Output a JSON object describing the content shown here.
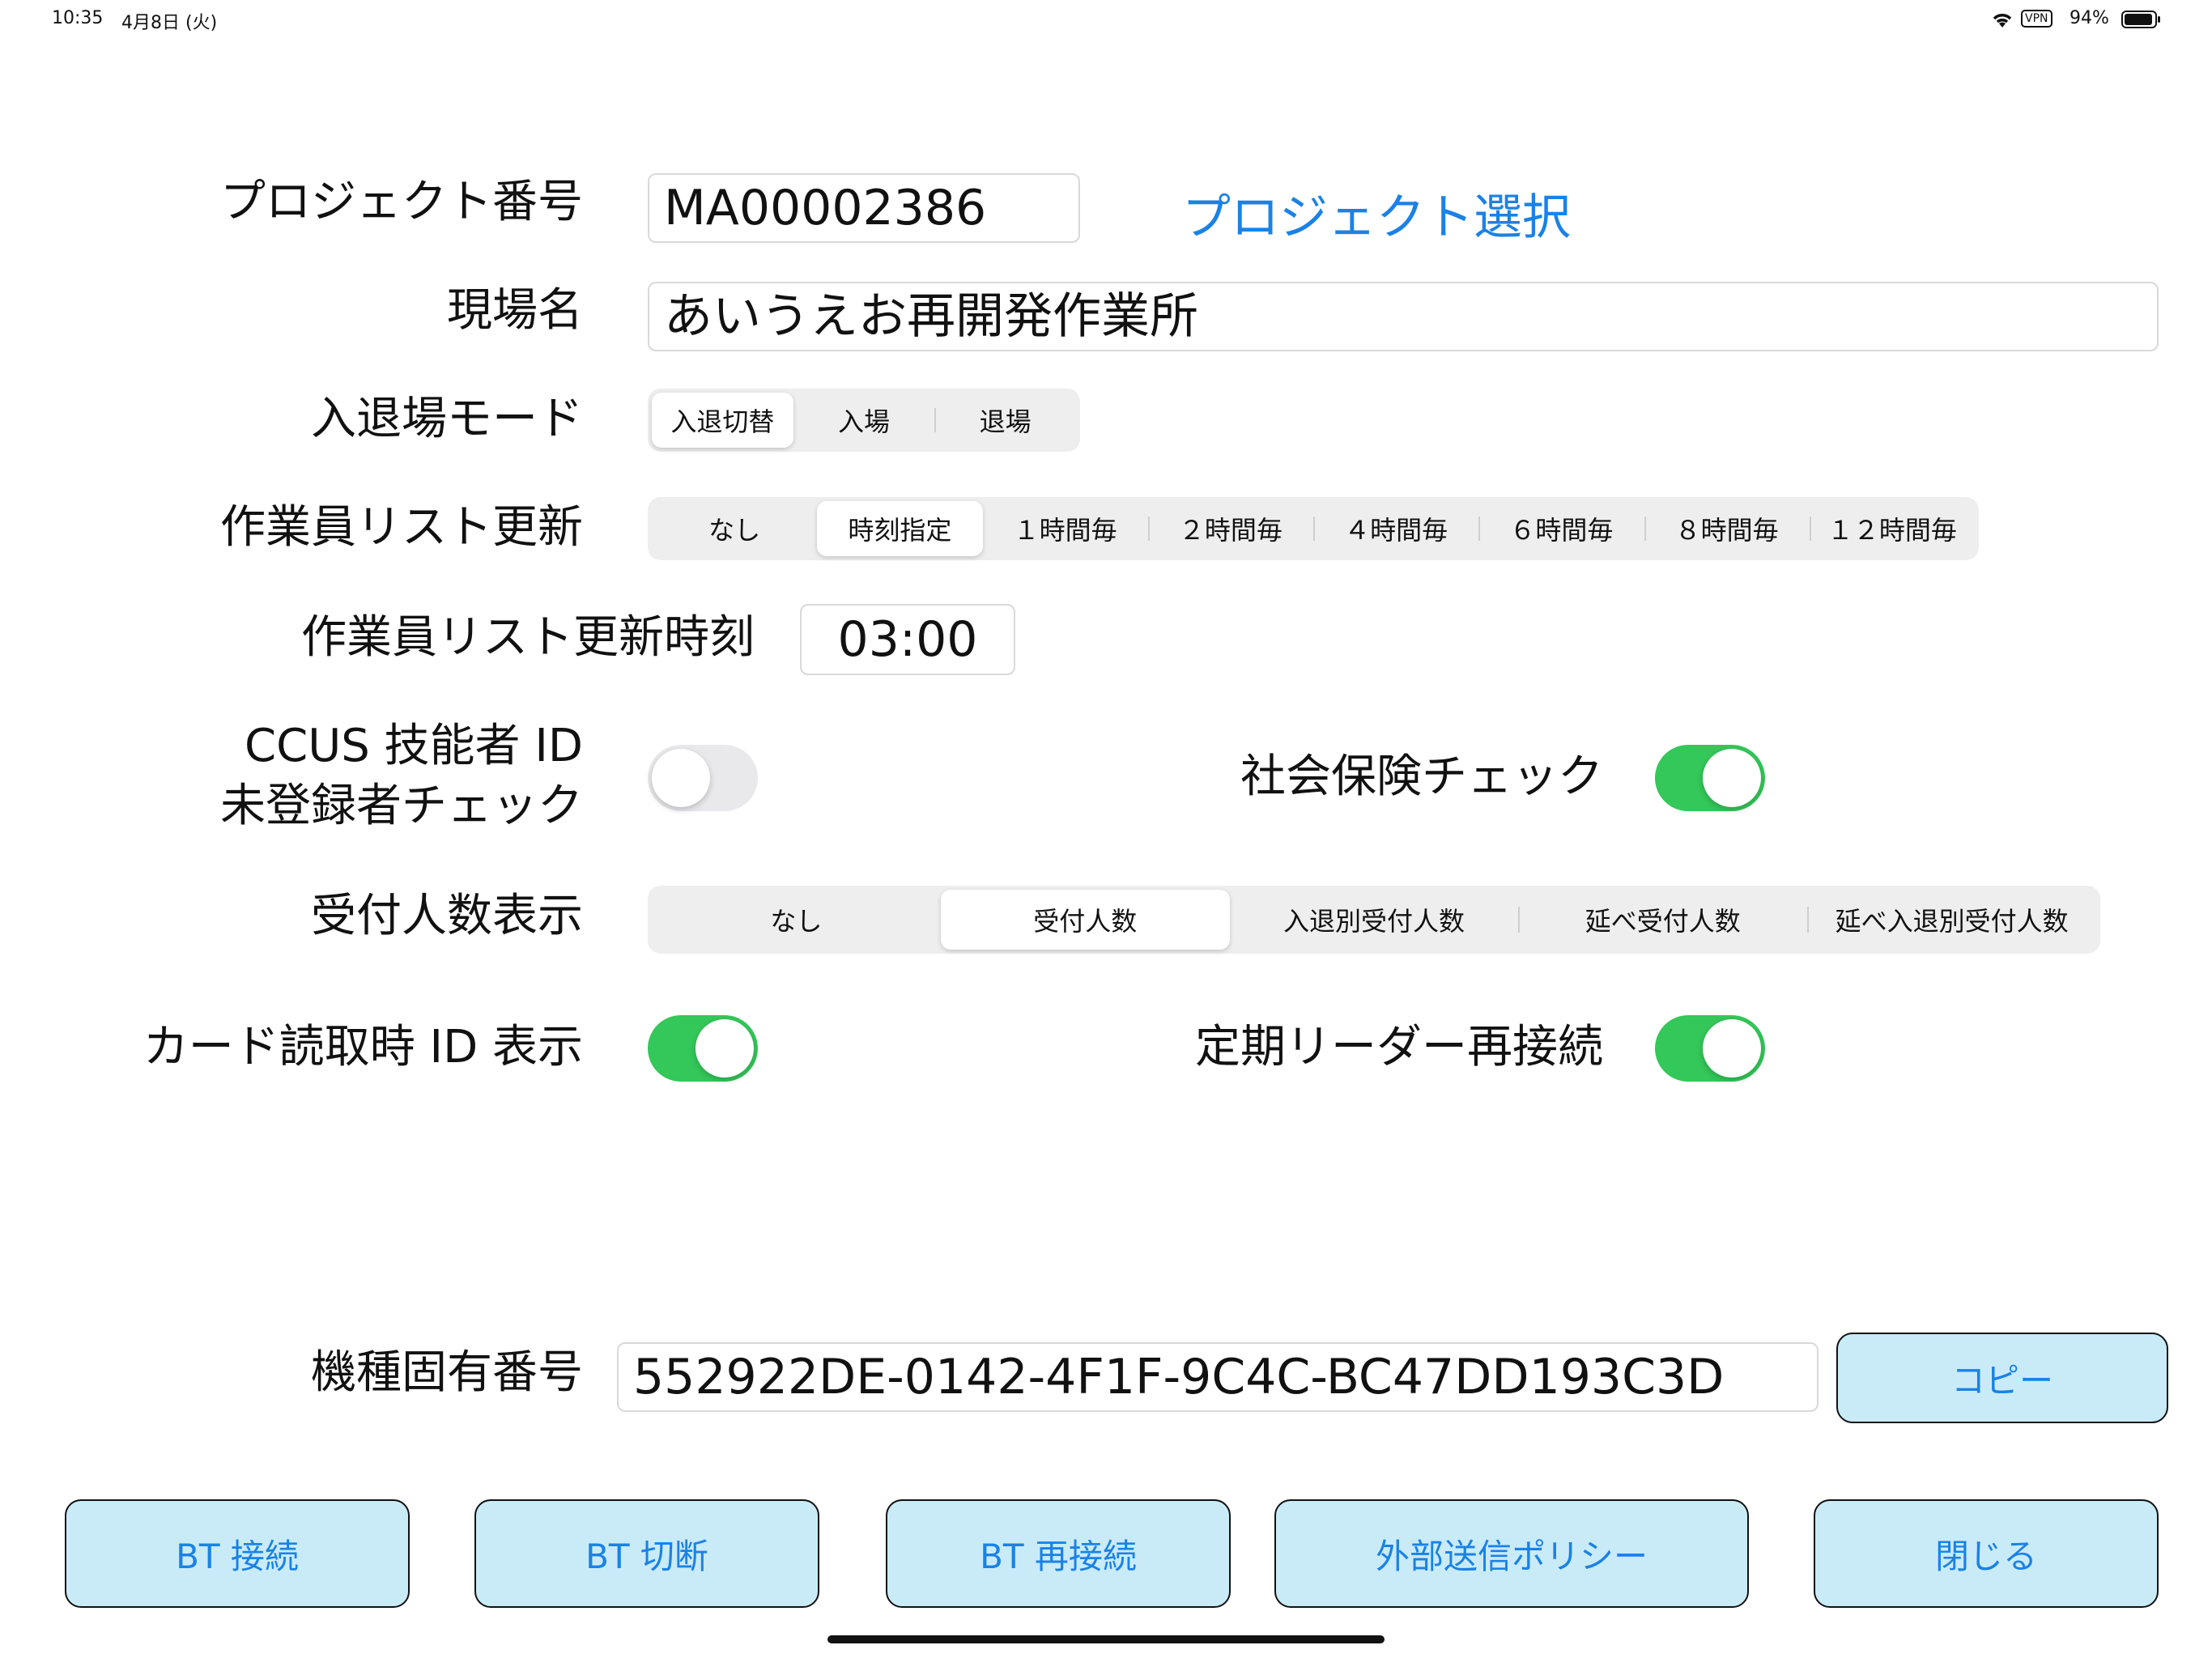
{
  "status_bar": {
    "time": "10:35",
    "date": "4月8日 (火)",
    "vpn": "VPN",
    "battery": "94%"
  },
  "project": {
    "label": "プロジェクト番号",
    "value": "MA00002386",
    "select_link": "プロジェクト選択"
  },
  "site": {
    "label": "現場名",
    "value": "あいうえお再開発作業所"
  },
  "entry_mode": {
    "label": "入退場モード",
    "options": [
      "入退切替",
      "入場",
      "退場"
    ],
    "selected": 0
  },
  "worker_list_update": {
    "label": "作業員リスト更新",
    "options": [
      "なし",
      "時刻指定",
      "１時間毎",
      "２時間毎",
      "４時間毎",
      "６時間毎",
      "８時間毎",
      "１２時間毎"
    ],
    "selected": 1
  },
  "update_time": {
    "label": "作業員リスト更新時刻",
    "value": "03:00"
  },
  "ccus_check": {
    "label_line1": "CCUS 技能者 ID",
    "label_line2": "未登録者チェック",
    "on": false
  },
  "insurance_check": {
    "label": "社会保険チェック",
    "on": true
  },
  "reception_count": {
    "label": "受付人数表示",
    "options": [
      "なし",
      "受付人数",
      "入退別受付人数",
      "延べ受付人数",
      "延べ入退別受付人数"
    ],
    "selected": 1
  },
  "card_id_display": {
    "label": "カード読取時 ID 表示",
    "on": true
  },
  "reader_reconnect": {
    "label": "定期リーダー再接続",
    "on": true
  },
  "device_id": {
    "label": "機種固有番号",
    "value": "552922DE-0142-4F1F-9C4C-BC47DD193C3D",
    "copy_button": "コピー"
  },
  "footer_buttons": {
    "bt_connect": "BT 接続",
    "bt_disconnect": "BT 切断",
    "bt_reconnect": "BT 再接続",
    "external_policy": "外部送信ポリシー",
    "close": "閉じる"
  },
  "colors": {
    "accent": "#1a82e6",
    "toggle_on": "#34c759",
    "button_bg": "#c9ebf8"
  }
}
